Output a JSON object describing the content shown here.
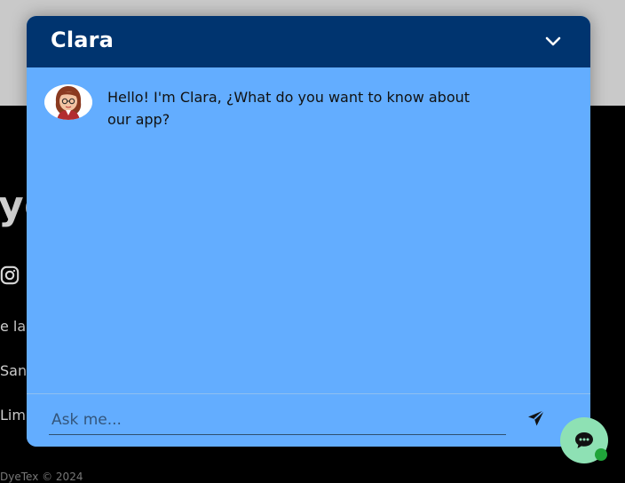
{
  "background": {
    "brand_fragment": "ye",
    "lines": [
      "e la",
      "San",
      "Lima"
    ],
    "footer": "DyeTex © 2024",
    "social_icon": "instagram-icon"
  },
  "chat": {
    "title": "Clara",
    "collapse_icon": "chevron-down-icon",
    "messages": [
      {
        "sender": "Clara",
        "avatar_icon": "avatar-icon",
        "text": "Hello! I'm Clara, ¿What do you want to know about our app?"
      }
    ],
    "input": {
      "placeholder": "Ask me...",
      "value": ""
    },
    "send_icon": "send-icon"
  },
  "launcher": {
    "icon": "chat-bubble-icon",
    "status": "online"
  },
  "colors": {
    "header": "#00346f",
    "panel": "#63adff",
    "launcher": "#8ee1b4",
    "online": "#20a43a"
  }
}
